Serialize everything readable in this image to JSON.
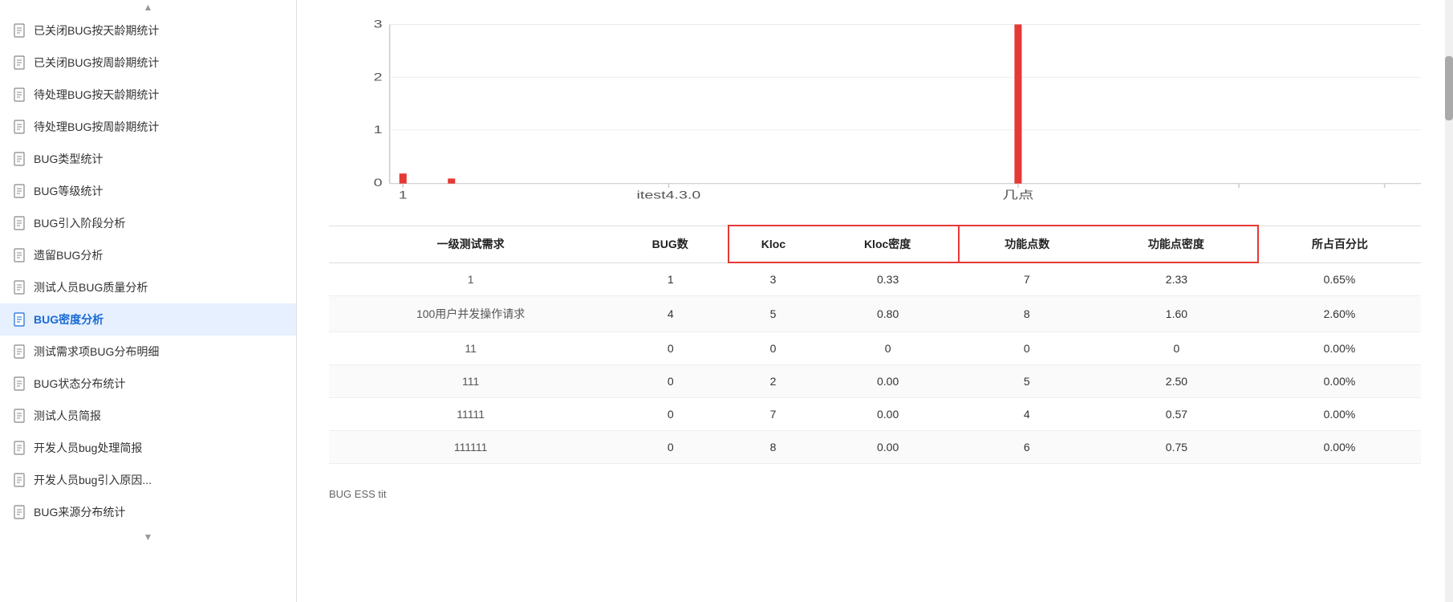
{
  "sidebar": {
    "items": [
      {
        "id": "closed-bug-daily",
        "label": "已关闭BUG按天龄期统计",
        "active": false
      },
      {
        "id": "closed-bug-weekly",
        "label": "已关闭BUG按周龄期统计",
        "active": false
      },
      {
        "id": "pending-bug-daily",
        "label": "待处理BUG按天龄期统计",
        "active": false
      },
      {
        "id": "pending-bug-weekly",
        "label": "待处理BUG按周龄期统计",
        "active": false
      },
      {
        "id": "bug-type",
        "label": "BUG类型统计",
        "active": false
      },
      {
        "id": "bug-level",
        "label": "BUG等级统计",
        "active": false
      },
      {
        "id": "bug-intro",
        "label": "BUG引入阶段分析",
        "active": false
      },
      {
        "id": "legacy-bug",
        "label": "遗留BUG分析",
        "active": false
      },
      {
        "id": "tester-bug-quality",
        "label": "测试人员BUG质量分析",
        "active": false
      },
      {
        "id": "bug-density",
        "label": "BUG密度分析",
        "active": true
      },
      {
        "id": "test-req-bug-detail",
        "label": "测试需求项BUG分布明细",
        "active": false
      },
      {
        "id": "bug-status-dist",
        "label": "BUG状态分布统计",
        "active": false
      },
      {
        "id": "tester-report",
        "label": "测试人员简报",
        "active": false
      },
      {
        "id": "dev-bug-report",
        "label": "开发人员bug处理简报",
        "active": false
      },
      {
        "id": "dev-bug-cause",
        "label": "开发人员bug引入原因...",
        "active": false
      },
      {
        "id": "bug-source-dist",
        "label": "BUG来源分布统计",
        "active": false
      }
    ]
  },
  "chart": {
    "y_labels": [
      "3",
      "2",
      "1",
      "0"
    ],
    "x_labels": [
      "1",
      "itest4.3.0",
      "几点"
    ],
    "bars": [
      {
        "x": 0.02,
        "height_ratio": 0.06,
        "color": "#e53935"
      },
      {
        "x": 0.07,
        "height_ratio": 0.03,
        "color": "#e53935"
      },
      {
        "x": 0.62,
        "height_ratio": 1.0,
        "color": "#e53935"
      }
    ]
  },
  "table": {
    "headers": [
      {
        "label": "一级测试需求",
        "group": "none"
      },
      {
        "label": "BUG数",
        "group": "none"
      },
      {
        "label": "Kloc",
        "group": "kloc-left"
      },
      {
        "label": "Kloc密度",
        "group": "kloc-right"
      },
      {
        "label": "功能点数",
        "group": "func-left"
      },
      {
        "label": "功能点密度",
        "group": "func-right"
      },
      {
        "label": "所占百分比",
        "group": "none"
      }
    ],
    "rows": [
      {
        "req": "1",
        "bug": "1",
        "kloc": "3",
        "kloc_density": "0.33",
        "func": "7",
        "func_density": "2.33",
        "percent": "0.65%"
      },
      {
        "req": "100用户并发操作请求",
        "bug": "4",
        "kloc": "5",
        "kloc_density": "0.80",
        "func": "8",
        "func_density": "1.60",
        "percent": "2.60%"
      },
      {
        "req": "11",
        "bug": "0",
        "kloc": "0",
        "kloc_density": "0",
        "func": "0",
        "func_density": "0",
        "percent": "0.00%"
      },
      {
        "req": "111",
        "bug": "0",
        "kloc": "2",
        "kloc_density": "0.00",
        "func": "5",
        "func_density": "2.50",
        "percent": "0.00%"
      },
      {
        "req": "11111",
        "bug": "0",
        "kloc": "7",
        "kloc_density": "0.00",
        "func": "4",
        "func_density": "0.57",
        "percent": "0.00%"
      },
      {
        "req": "111111",
        "bug": "0",
        "kloc": "8",
        "kloc_density": "0.00",
        "func": "6",
        "func_density": "0.75",
        "percent": "0.00%"
      }
    ]
  },
  "bottom_label": "BUG ESS  tit"
}
